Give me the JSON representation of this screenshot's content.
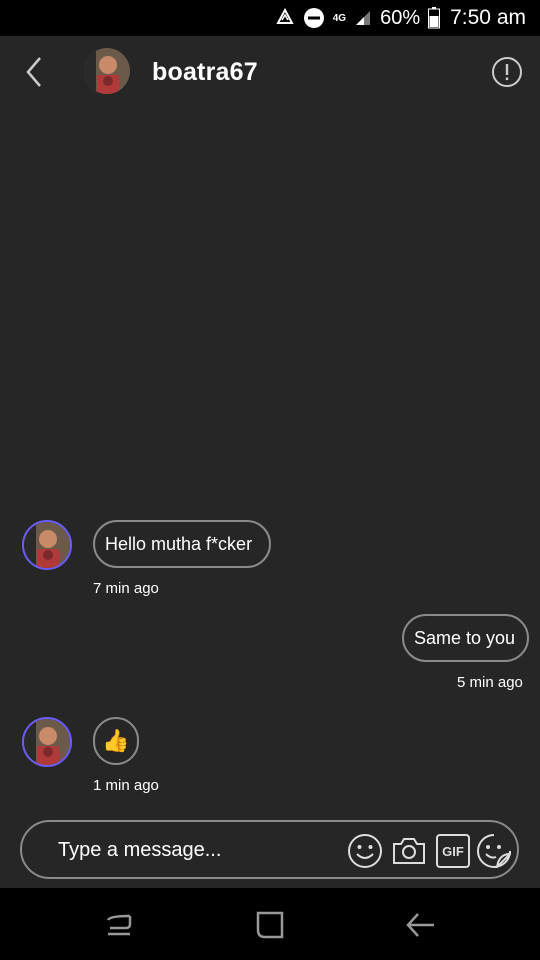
{
  "status_bar": {
    "network_top": "4G",
    "battery_percent": "60%",
    "time": "7:50 am"
  },
  "header": {
    "username": "boatra67"
  },
  "messages": [
    {
      "sender": "other",
      "text": "Hello mutha f*cker",
      "time": "7 min ago"
    },
    {
      "sender": "me",
      "text": "Same to you",
      "time": "5 min ago"
    },
    {
      "sender": "other",
      "emoji": "👍",
      "time": "1 min ago"
    }
  ],
  "composer": {
    "placeholder": "Type a message...",
    "icons": [
      "emoji-icon",
      "camera-icon",
      "gif-icon",
      "sticker-icon"
    ],
    "gif_label": "GIF"
  },
  "colors": {
    "background": "#262626",
    "avatar_ring": "#6a5cff",
    "bubble_border": "#8a8a8a"
  }
}
